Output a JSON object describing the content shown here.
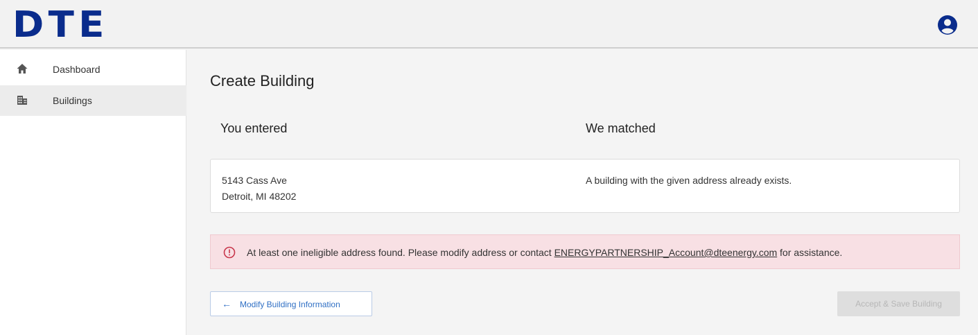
{
  "header": {
    "logo_text": "DTE",
    "avatar_icon": "account-circle-icon"
  },
  "sidebar": {
    "items": [
      {
        "label": "Dashboard",
        "icon": "home-icon",
        "active": false
      },
      {
        "label": "Buildings",
        "icon": "buildings-icon",
        "active": true
      }
    ]
  },
  "main": {
    "title": "Create Building",
    "entered_heading": "You entered",
    "matched_heading": "We matched",
    "entered_address": {
      "line1": "5143 Cass Ave",
      "line2": "Detroit, MI 48202"
    },
    "matched_message": "A building with the given address already exists.",
    "alert": {
      "icon": "alert-circle-icon",
      "text_before": "At least one ineligible address found. Please modify address or contact ",
      "link_text": "ENERGYPARTNERSHIP_Account@dteenergy.com",
      "text_after": " for assistance."
    },
    "buttons": {
      "back_label": "Modify Building Information",
      "save_label": "Accept & Save Building"
    }
  },
  "colors": {
    "brand": "#0a2c8c",
    "alert_bg": "#f8e0e4",
    "alert_icon": "#c8364b",
    "link_blue": "#2f6fc4",
    "disabled_bg": "#dedede"
  }
}
